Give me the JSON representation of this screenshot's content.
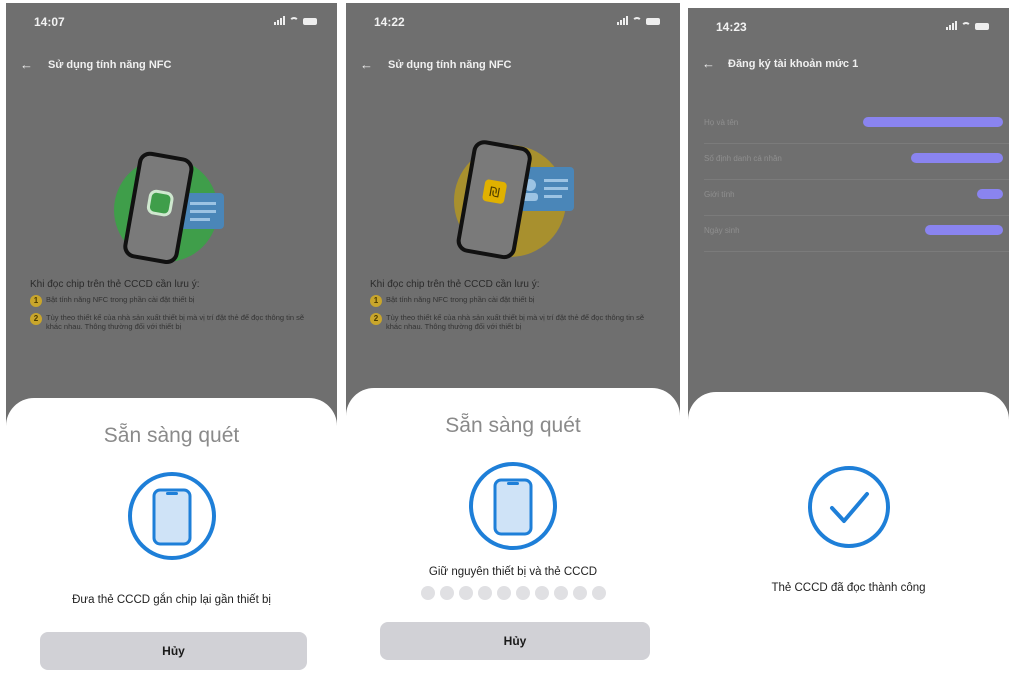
{
  "screens": [
    {
      "time": "14:07",
      "nav_title": "Sử dụng tính năng NFC",
      "note_heading": "Khi đọc chip trên thẻ CCCD cần lưu ý:",
      "notes": [
        {
          "num": "1",
          "text": "Bật tính năng NFC trong phần cài đặt thiết bị"
        },
        {
          "num": "2",
          "text": "Tùy theo thiết kế của nhà sản xuất thiết bị mà vị trí đặt thẻ để đọc thông tin sẽ khác nhau. Thông thường đối với thiết bị"
        }
      ],
      "sheet_title": "Sẵn sàng quét",
      "message": "Đưa thẻ CCCD gắn chip lại gần thiết bị",
      "cancel_label": "Hủy",
      "illustration_circle_color": "#3f9e4a"
    },
    {
      "time": "14:22",
      "nav_title": "Sử dụng tính năng NFC",
      "note_heading": "Khi đọc chip trên thẻ CCCD cần lưu ý:",
      "notes": [
        {
          "num": "1",
          "text": "Bật tính năng NFC trong phần cài đặt thiết bị"
        },
        {
          "num": "2",
          "text": "Tùy theo thiết kế của nhà sản xuất thiết bị mà vị trí đặt thẻ để đọc thông tin sẽ khác nhau. Thông thường đối với thiết bị"
        }
      ],
      "sheet_title": "Sẵn sàng quét",
      "message": "Giữ nguyên thiết bị và thẻ CCCD",
      "progress_dots": 10,
      "cancel_label": "Hủy",
      "illustration_circle_color": "#a8902e"
    },
    {
      "time": "14:23",
      "nav_title": "Đăng ký tài khoản mức 1",
      "fields": [
        {
          "label": "Họ và tên"
        },
        {
          "label": "Số định danh cá nhân"
        },
        {
          "label": "Giới tính"
        },
        {
          "label": "Ngày sinh"
        }
      ],
      "success_message": "Thẻ CCCD đã đọc thành công"
    }
  ],
  "colors": {
    "accent_blue": "#1e7fd8",
    "redaction": "#8a84f0",
    "overlay": "#6f6f6f"
  }
}
